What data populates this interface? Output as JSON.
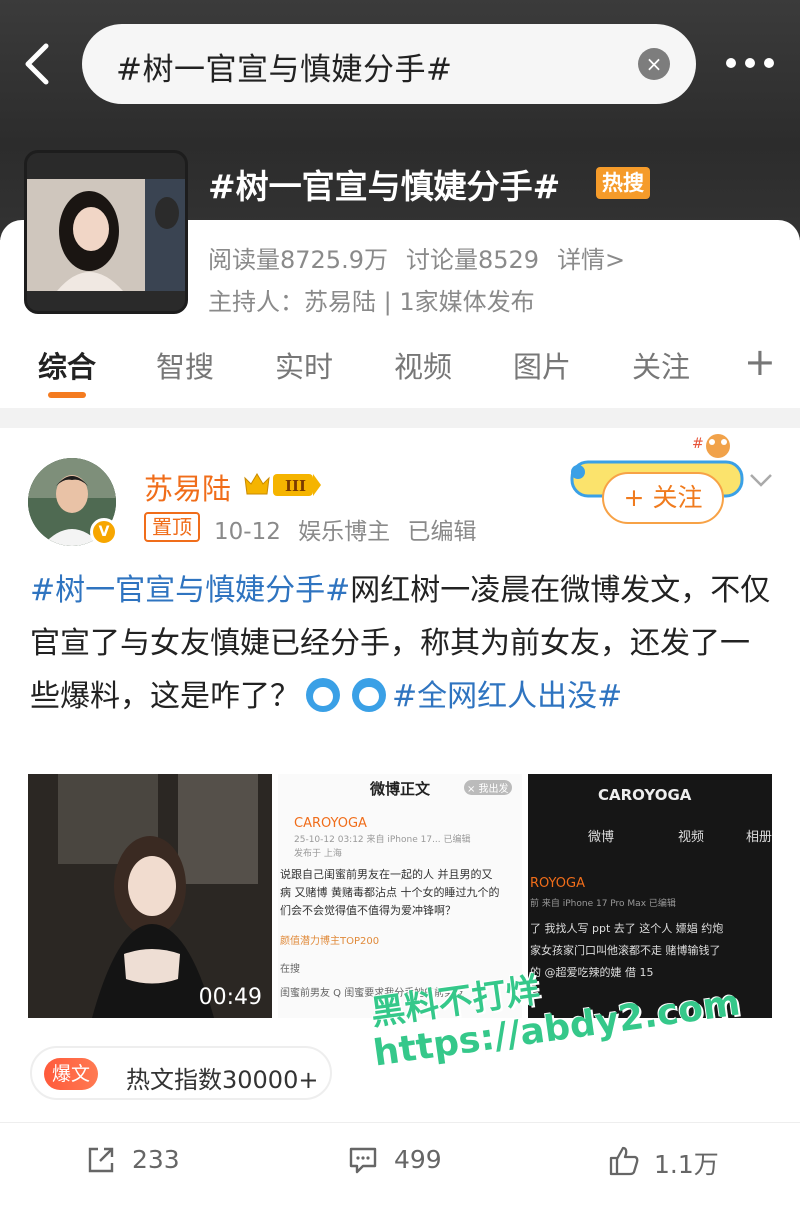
{
  "search": {
    "query": "#树一官宣与慎婕分手#",
    "clear_icon": "×"
  },
  "topic": {
    "title": "#树一官宣与慎婕分手#",
    "badge": "热搜",
    "reads": "阅读量8725.9万",
    "discussions": "讨论量8529",
    "details": "详情>",
    "host": "主持人：苏易陆 | 1家媒体发布"
  },
  "tabs": [
    "综合",
    "智搜",
    "实时",
    "视频",
    "图片",
    "关注"
  ],
  "tabs_plus": "+",
  "post": {
    "username": "苏易陆",
    "vip_level": "III",
    "pinned": "置顶",
    "date": "10-12",
    "role": "娱乐博主",
    "edited": "已编辑",
    "follow": "+ 关注",
    "text_hashtag1": "#树一官宣与慎婕分手#",
    "text_body": "网红树一凌晨在微博发文，不仅官宣了与女友慎婕已经分手，称其为前女友，还发了一些爆料，这是咋了？",
    "text_hashtag2": "#全网红人出没#",
    "video_duration": "00:49",
    "hot_badge": "爆文",
    "hot_index": "热文指数30000+",
    "reposts": "233",
    "comments": "499",
    "likes": "1.1万"
  },
  "shot2": {
    "title": "微博正文",
    "close": "× 我出发",
    "account": "CAROYOGA",
    "time": "25-10-12 03:12  来自 iPhone 17...  已编辑",
    "location": "发布于 上海",
    "l1": "说跟自己闺蜜前男友在一起的人 并且男的又",
    "l2": "病 又赌博 黄赌毒都沾点 十个女的睡过九个的",
    "l3": "们会不会觉得值不值得为爱冲锋啊？",
    "l4": "颜值潜力博主TOP200",
    "l5": "在搜",
    "l6": "闺蜜前男友    Q 闺蜜要求我分手她的前男友"
  },
  "shot3": {
    "title": "CAROYOGA",
    "tab1": "微博",
    "tab2": "视频",
    "tab3": "相册",
    "account": "ROYOGA",
    "time": "前  来自 iPhone 17 Pro Max  已编辑",
    "l1": "了 我找人写 ppt 去了 这个人 嫖娼 约炮",
    "l2": "家女孩家门口叫他滚都不走 赌博输钱了",
    "l3": "的 @超爱吃辣的婕 借 15"
  },
  "watermark": {
    "line1": "黑料不打烊",
    "line2": "https://abdy2.com"
  },
  "colors": {
    "accent": "#f06d1a",
    "hashtag": "#2f74c0",
    "hot": "#f59b2a"
  }
}
